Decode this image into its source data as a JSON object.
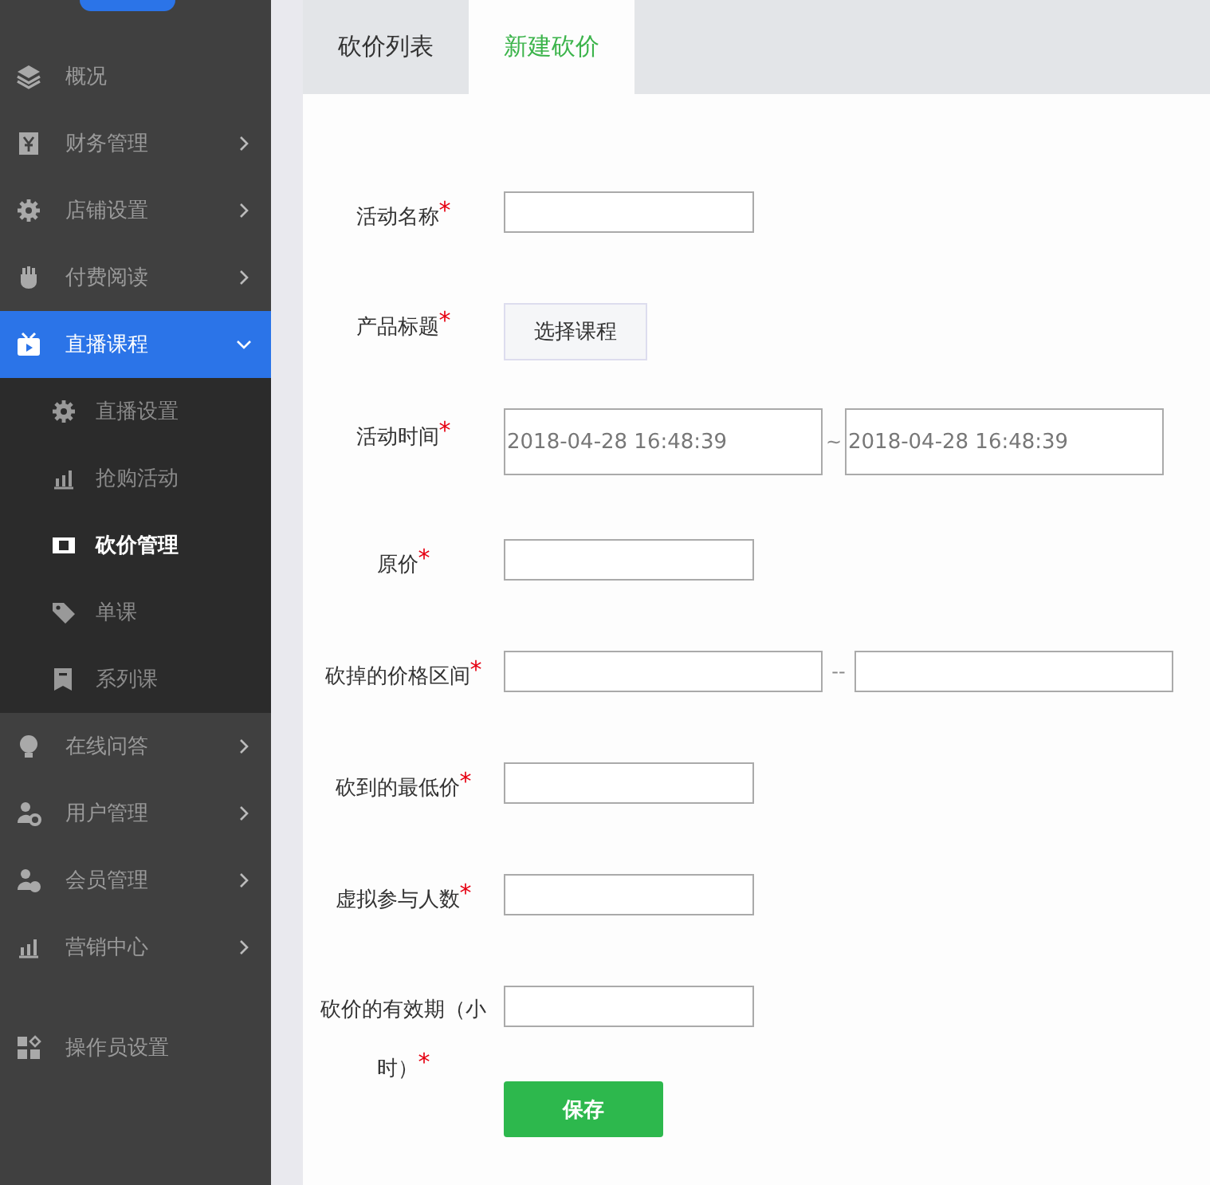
{
  "sidebar": {
    "items": [
      {
        "label": "概况",
        "kind": "link",
        "selected": false
      },
      {
        "label": "财务管理",
        "kind": "group",
        "selected": false,
        "expanded": false
      },
      {
        "label": "店铺设置",
        "kind": "group",
        "selected": false,
        "expanded": false
      },
      {
        "label": "付费阅读",
        "kind": "group",
        "selected": false,
        "expanded": false
      },
      {
        "label": "直播课程",
        "kind": "group",
        "selected": true,
        "expanded": true,
        "children": [
          {
            "label": "直播设置",
            "selected": false
          },
          {
            "label": "抢购活动",
            "selected": false
          },
          {
            "label": "砍价管理",
            "selected": true
          },
          {
            "label": "单课",
            "selected": false
          },
          {
            "label": "系列课",
            "selected": false
          }
        ]
      },
      {
        "label": "在线问答",
        "kind": "group",
        "selected": false,
        "expanded": false
      },
      {
        "label": "用户管理",
        "kind": "group",
        "selected": false,
        "expanded": false
      },
      {
        "label": "会员管理",
        "kind": "group",
        "selected": false,
        "expanded": false
      },
      {
        "label": "营销中心",
        "kind": "group",
        "selected": false,
        "expanded": false
      },
      {
        "label": "操作员设置",
        "kind": "link",
        "selected": false
      }
    ]
  },
  "tabs": [
    {
      "label": "砍价列表",
      "selected": false
    },
    {
      "label": "新建砍价",
      "selected": true
    }
  ],
  "form": {
    "fields": [
      {
        "label": "活动名称$^{*}$",
        "kind": "text"
      },
      {
        "label": "产品标题$^{*}$",
        "kind": "button",
        "button": "选择课程"
      },
      {
        "label": "活动时间$^{*}$",
        "kind": "date_range",
        "start": "2018-04-28 16:48:39",
        "separator": "~",
        "end": "2018-04-28 16:48:39"
      },
      {
        "label": "原价$^{*}$",
        "kind": "text"
      },
      {
        "label": "砍掉的价格区间$^{*}$",
        "kind": "range",
        "separator": "--"
      },
      {
        "label": "砍到的最低价$^{*}$",
        "kind": "text"
      },
      {
        "label": "虚拟参与人数$^{*}$",
        "kind": "text"
      },
      {
        "label": "砍价的有效期（小时）$^{*}$",
        "kind": "text"
      }
    ],
    "submit": "保存"
  }
}
